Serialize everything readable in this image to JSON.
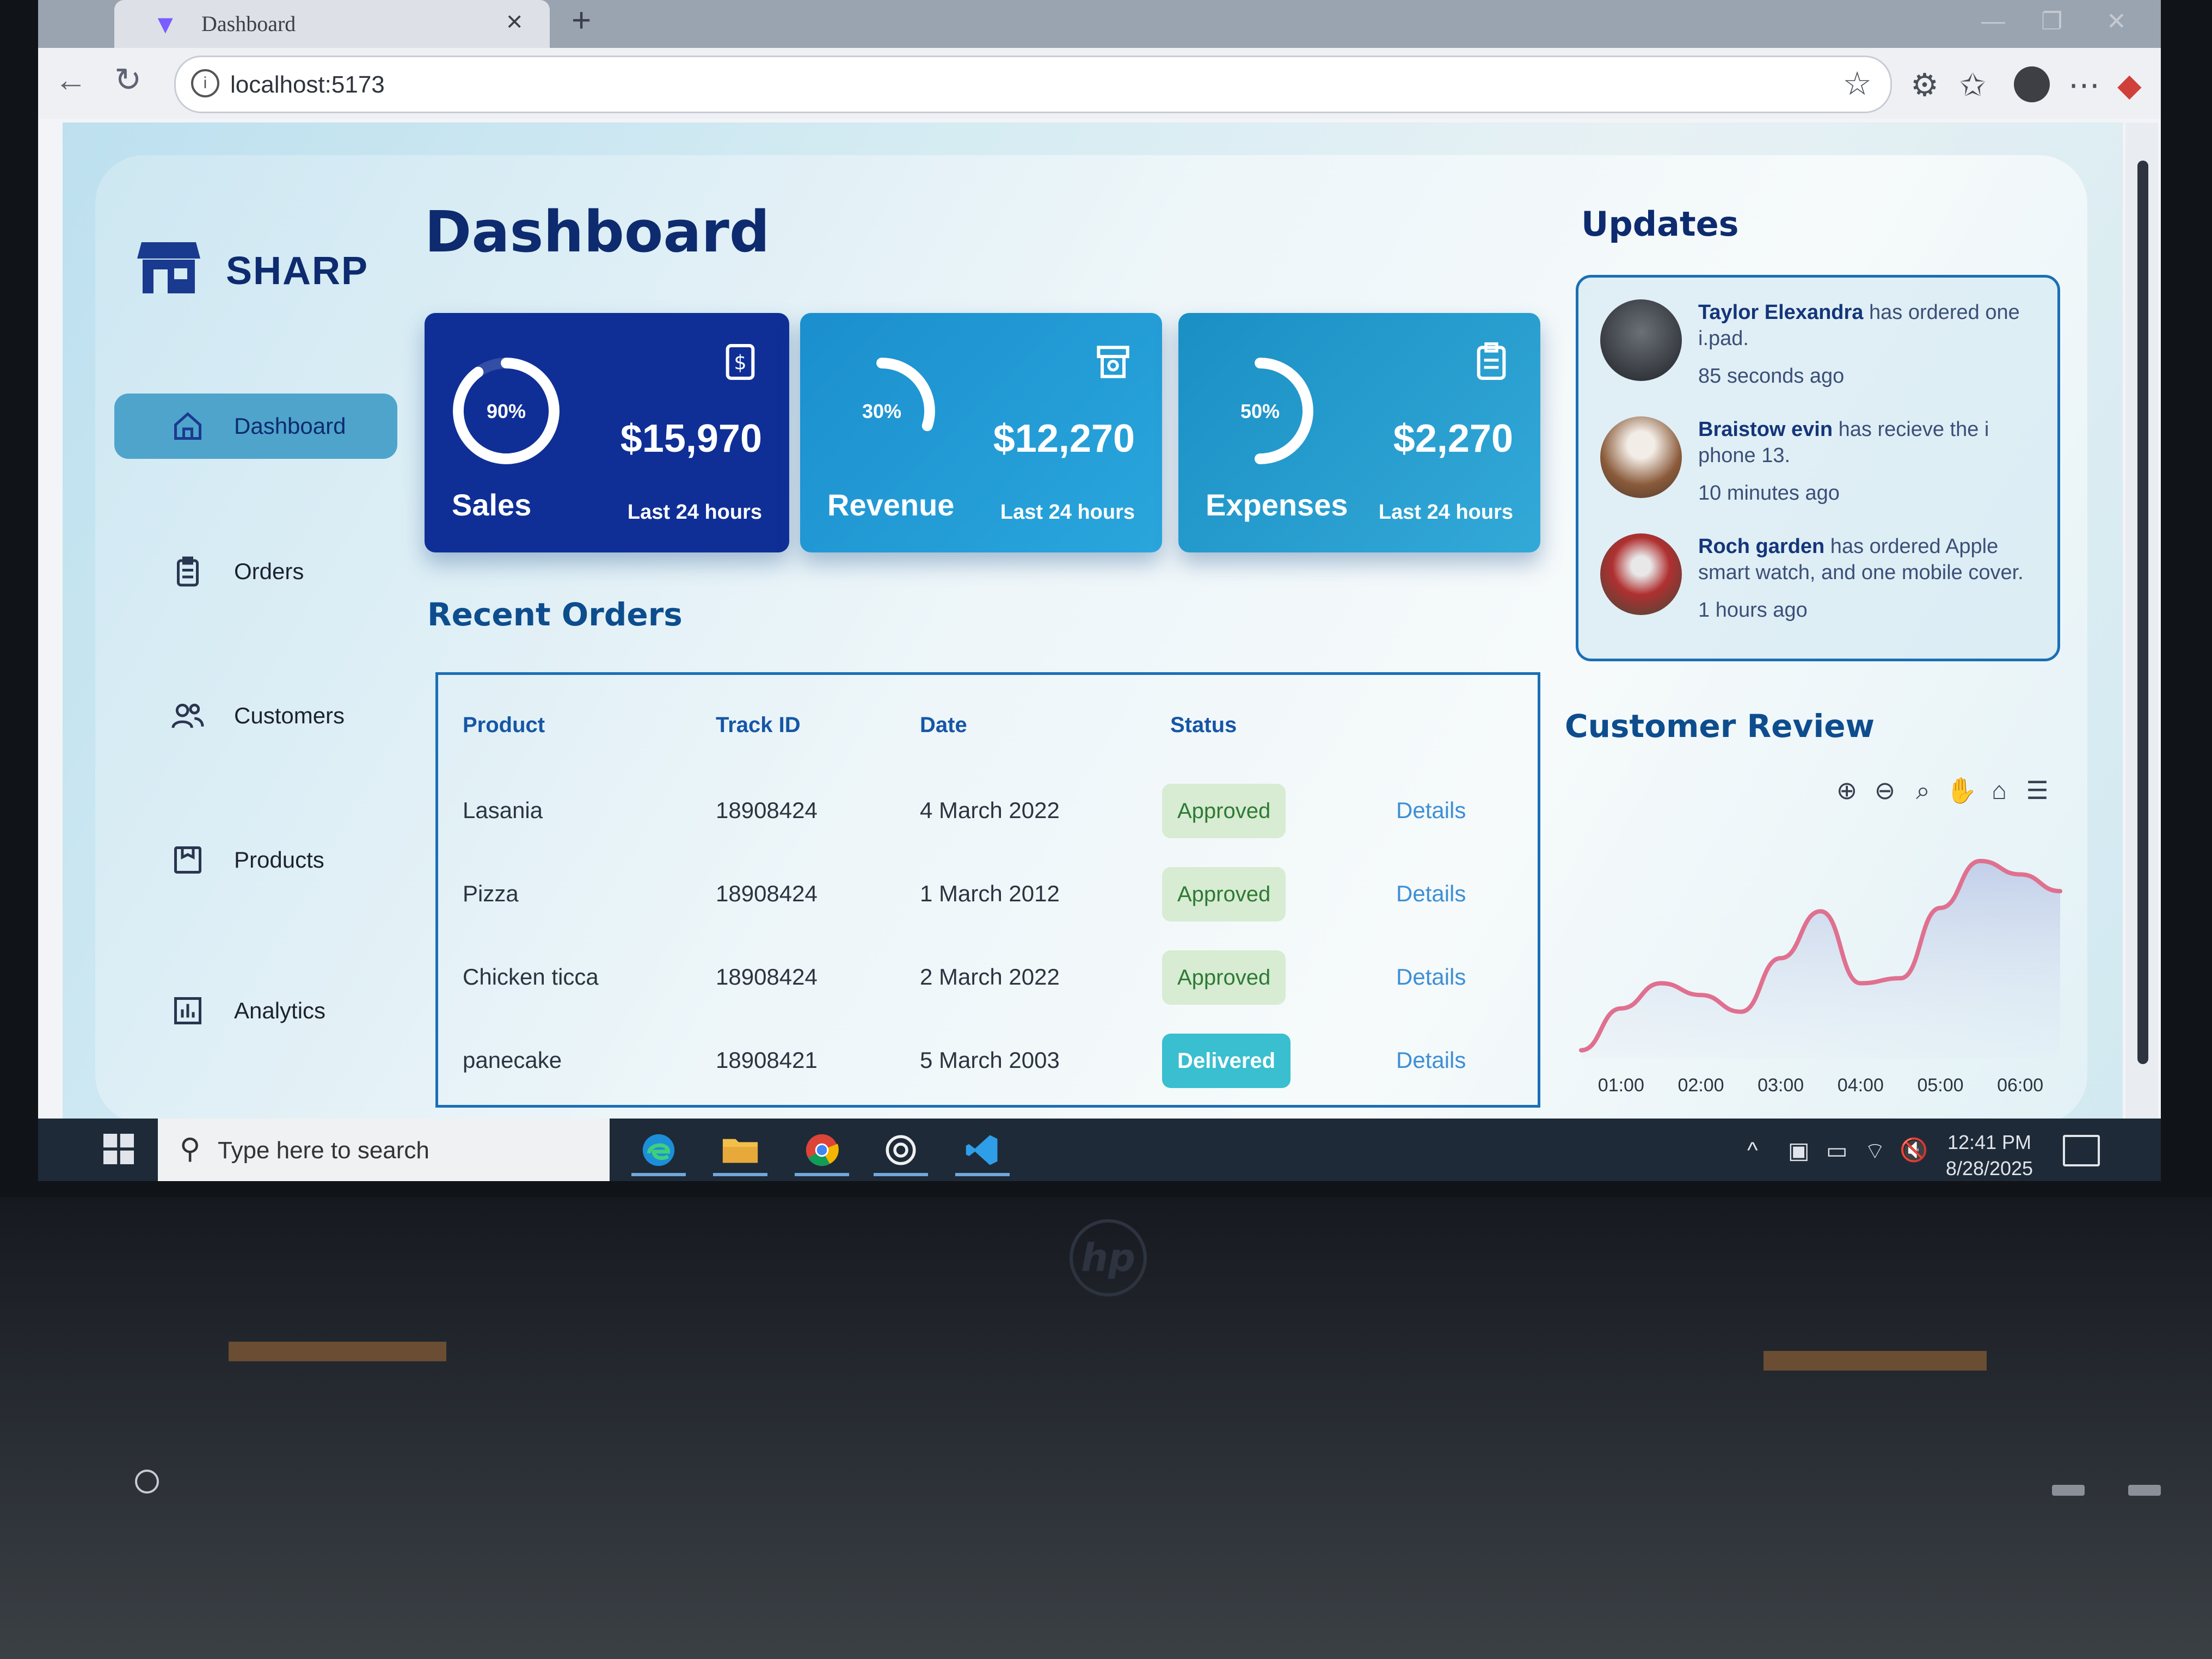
{
  "browser": {
    "tab_title": "Dashboard",
    "url": "localhost:5173"
  },
  "sidebar": {
    "brand": "SHARP",
    "items": [
      {
        "label": "Dashboard",
        "icon": "home-icon",
        "active": true
      },
      {
        "label": "Orders",
        "icon": "clipboard-icon",
        "active": false
      },
      {
        "label": "Customers",
        "icon": "users-icon",
        "active": false
      },
      {
        "label": "Products",
        "icon": "box-icon",
        "active": false
      },
      {
        "label": "Analytics",
        "icon": "bar-chart-icon",
        "active": false
      }
    ]
  },
  "main": {
    "title": "Dashboard",
    "stats": [
      {
        "title": "Sales",
        "value": "$15,970",
        "sub": "Last 24 hours",
        "percent_label": "90%",
        "percent": 0.9,
        "icon": "dollar-icon",
        "color": "#0f2f96"
      },
      {
        "title": "Revenue",
        "value": "$12,270",
        "sub": "Last 24 hours",
        "percent_label": "30%",
        "percent": 0.3,
        "icon": "cash-register-icon",
        "color": "#1b8fce"
      },
      {
        "title": "Expenses",
        "value": "$2,270",
        "sub": "Last 24 hours",
        "percent_label": "50%",
        "percent": 0.5,
        "icon": "clipboard-icon",
        "color": "#1a8fc4"
      }
    ],
    "recent_orders": {
      "title": "Recent Orders",
      "columns": [
        "Product",
        "Track ID",
        "Date",
        "Status"
      ],
      "rows": [
        {
          "product": "Lasania",
          "track_id": "18908424",
          "date": "4 March 2022",
          "status": "Approved",
          "action": "Details"
        },
        {
          "product": "Pizza",
          "track_id": "18908424",
          "date": "1 March 2012",
          "status": "Approved",
          "action": "Details"
        },
        {
          "product": "Chicken ticca",
          "track_id": "18908424",
          "date": "2 March 2022",
          "status": "Approved",
          "action": "Details"
        },
        {
          "product": "panecake",
          "track_id": "18908421",
          "date": "5 March 2003",
          "status": "Delivered",
          "action": "Details"
        }
      ]
    }
  },
  "updates": {
    "title": "Updates",
    "items": [
      {
        "name": "Taylor Elexandra",
        "text": " has ordered one i.pad.",
        "time": "85 seconds ago"
      },
      {
        "name": "Braistow evin",
        "text": " has recieve the i phone 13.",
        "time": "10 minutes ago"
      },
      {
        "name": "Roch garden",
        "text": " has ordered Apple smart watch, and one mobile cover.",
        "time": "1 hours ago"
      }
    ]
  },
  "customer_review": {
    "title": "Customer Review",
    "toolbar": [
      "zoom-in-icon",
      "zoom-out-icon",
      "zoom-select-icon",
      "pan-hand-icon",
      "home-icon",
      "menu-icon"
    ]
  },
  "chart_data": {
    "type": "area",
    "x": [
      "00:30",
      "01:00",
      "01:30",
      "02:00",
      "02:30",
      "03:00",
      "03:30",
      "04:00",
      "04:30",
      "05:00",
      "05:30",
      "06:00",
      "06:30"
    ],
    "x_ticks": [
      "01:00",
      "02:00",
      "03:00",
      "04:00",
      "05:00",
      "06:00"
    ],
    "series": [
      {
        "values": [
          5,
          30,
          45,
          38,
          28,
          60,
          88,
          45,
          48,
          90,
          118,
          110,
          100
        ]
      }
    ],
    "ylim": [
      0,
      130
    ],
    "color": "#e0708f",
    "grid": false
  },
  "taskbar": {
    "search_placeholder": "Type here to search",
    "apps": [
      "edge-icon",
      "file-explorer-icon",
      "chrome-icon",
      "chatgpt-icon",
      "vscode-icon"
    ],
    "time": "12:41 PM",
    "date": "8/28/2025"
  }
}
